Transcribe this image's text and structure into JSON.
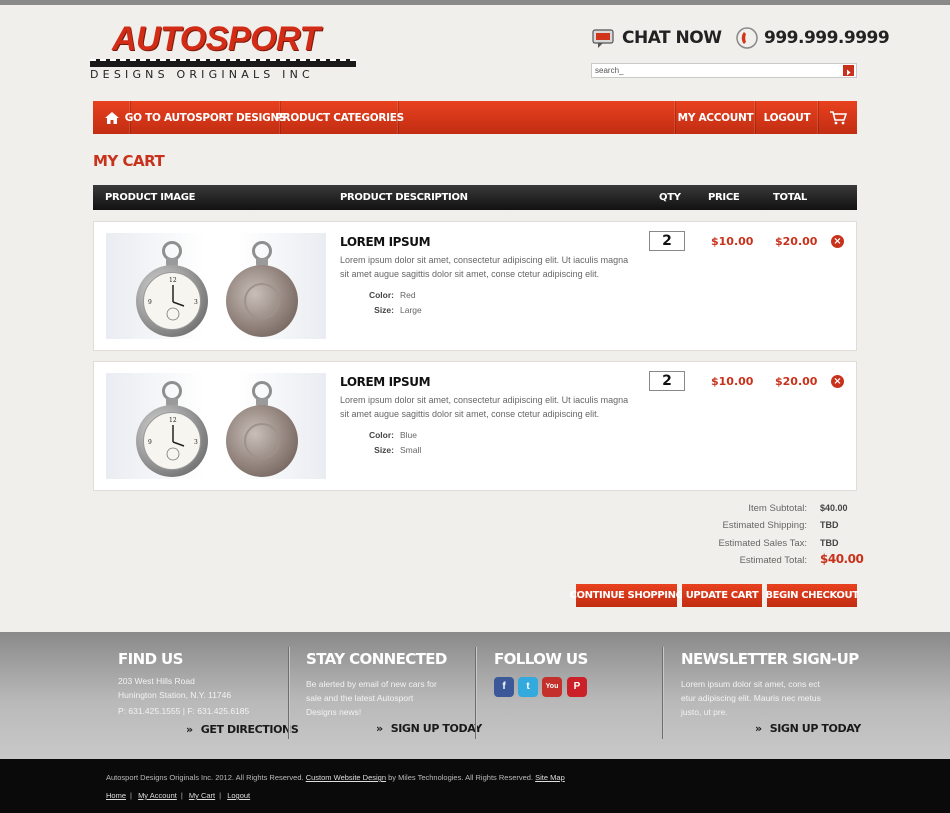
{
  "header": {
    "logo_main": "AUTOSPORT",
    "logo_sub": "DESIGNS ORIGINALS INC",
    "chat_label": "CHAT NOW",
    "phone": "999.999.9999",
    "search_value": "search_"
  },
  "nav": {
    "items": [
      "GO TO AUTOSPORT DESIGNS",
      "PRODUCT CATEGORIES",
      "MY ACCOUNT",
      "LOGOUT"
    ]
  },
  "page_title": "MY CART",
  "table_headers": {
    "image": "PRODUCT IMAGE",
    "description": "PRODUCT DESCRIPTION",
    "qty": "QTY",
    "price": "PRICE",
    "total": "TOTAL"
  },
  "items": [
    {
      "name": "LOREM IPSUM",
      "description": "Lorem ipsum dolor sit amet, consectetur adipiscing elit. Ut iaculis magna sit amet augue sagittis dolor sit amet, conse ctetur adipiscing elit.",
      "color_label": "Color:",
      "color": "Red",
      "size_label": "Size:",
      "size": "Large",
      "qty": "2",
      "price": "$10.00",
      "total": "$20.00"
    },
    {
      "name": "LOREM IPSUM",
      "description": "Lorem ipsum dolor sit amet, consectetur adipiscing elit. Ut iaculis magna sit amet augue sagittis dolor sit amet, conse ctetur adipiscing elit.",
      "color_label": "Color:",
      "color": "Blue",
      "size_label": "Size:",
      "size": "Small",
      "qty": "2",
      "price": "$10.00",
      "total": "$20.00"
    }
  ],
  "totals": {
    "subtotal_label": "Item Subtotal:",
    "subtotal": "$40.00",
    "shipping_label": "Estimated Shipping:",
    "shipping": "TBD",
    "tax_label": "Estimated Sales Tax:",
    "tax": "TBD",
    "total_label": "Estimated Total:",
    "total": "$40.00"
  },
  "buttons": {
    "continue": "CONTINUE SHOPPING",
    "update": "UPDATE CART",
    "checkout": "BEGIN CHECKOUT"
  },
  "footer": {
    "find_us": {
      "title": "FIND US",
      "address1": "203 West Hills Road",
      "address2": "Hunington Station, N.Y. 11746",
      "phones": "P: 631.425.1555  |  F: 631.425.6185",
      "link": "GET DIRECTIONS"
    },
    "stay_connected": {
      "title": "STAY CONNECTED",
      "text": "Be alerted by email of new cars for sale and the latest Autosport Designs news!",
      "link": "SIGN UP TODAY"
    },
    "follow_us": {
      "title": "FOLLOW US",
      "icons": [
        "facebook-icon",
        "twitter-icon",
        "youtube-icon",
        "pinterest-icon"
      ]
    },
    "newsletter": {
      "title": "NEWSLETTER SIGN-UP",
      "text": "Lorem ipsum dolor sit amet, cons ect etur adipiscing elit. Mauris nec metus justo, ut pre.",
      "link": "SIGN UP TODAY"
    }
  },
  "bottom": {
    "copyright_pre": "Autosport Designs Originals Inc.  2012. All Rights Reserved.",
    "custom_design": "Custom Website Design",
    "copyright_mid": "by Miles Technologies. All Rights Reserved.",
    "site_map": "Site Map",
    "links": [
      "Home",
      "My Account",
      "My Cart",
      "Logout"
    ]
  },
  "colors": {
    "accent": "#c8321c",
    "nav_top": "#e8411f",
    "footer": "#a8a8a8",
    "bottom_bar": "#0a0a0a"
  }
}
